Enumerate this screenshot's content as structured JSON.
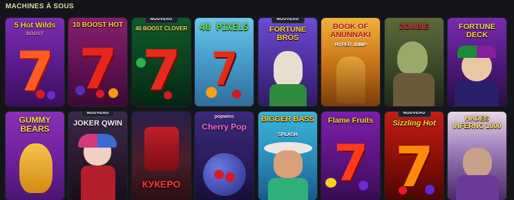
{
  "section": {
    "title": "MACHINES À SOUS"
  },
  "badge_label": "NOUVEAU",
  "games": [
    {
      "title": "5 Hot Wilds",
      "subtitle": "BOOST",
      "new": false
    },
    {
      "title": "10 BOOST HOT",
      "subtitle": "",
      "new": false
    },
    {
      "title": "40 BOOST CLOVER",
      "subtitle": "",
      "new": true
    },
    {
      "title": "40 PIXELS",
      "subtitle": "",
      "new": false
    },
    {
      "title": "FORTUNE BROS",
      "subtitle": "",
      "new": true
    },
    {
      "title": "BOOK OF ANUNNAKI",
      "subtitle": "HYPER JUMP",
      "new": false
    },
    {
      "title": "ZOMBIE",
      "subtitle": "",
      "new": false
    },
    {
      "title": "FORTUNE DECK",
      "subtitle": "",
      "new": false
    },
    {
      "title": "GUMMY BEARS",
      "subtitle": "",
      "new": false
    },
    {
      "title": "JOKER QWIN",
      "subtitle": "",
      "new": true
    },
    {
      "title": "КУКЕРО",
      "subtitle": "",
      "new": false
    },
    {
      "title": "Cherry Pop",
      "subtitle": "popwins",
      "new": false
    },
    {
      "title": "BIGGER BASS",
      "subtitle": "SPLASH",
      "new": false
    },
    {
      "title": "Flame Fruits",
      "subtitle": "",
      "new": false
    },
    {
      "title": "Sizzling Hot",
      "subtitle": "",
      "new": true
    },
    {
      "title": "HADES INFERNO 1000",
      "subtitle": "",
      "new": false
    }
  ]
}
